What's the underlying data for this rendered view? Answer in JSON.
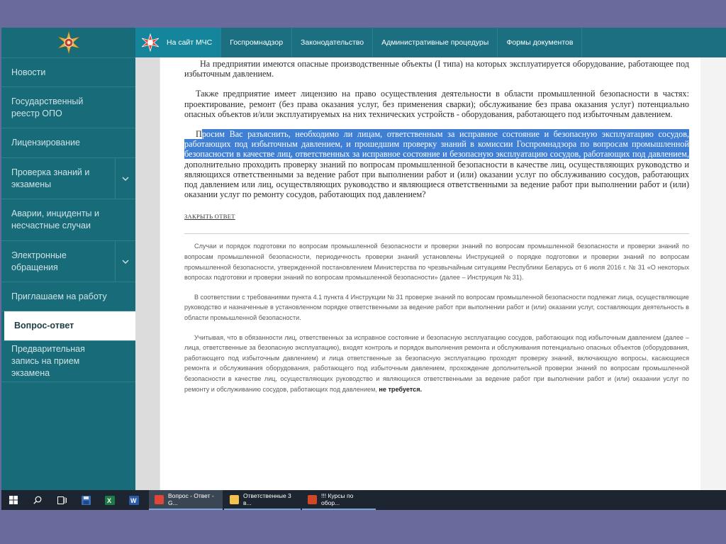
{
  "top_nav": {
    "home_label": "На сайт МЧС",
    "items": [
      "Госпромнадзор",
      "Законодательство",
      "Административные процедуры",
      "Формы документов"
    ]
  },
  "sidebar": {
    "items": [
      {
        "label": "Новости",
        "chevron": false
      },
      {
        "label": "Государственный реестр ОПО",
        "chevron": false
      },
      {
        "label": "Лицензирование",
        "chevron": false
      },
      {
        "label": "Проверка знаний и экзамены",
        "chevron": true
      },
      {
        "label": "Аварии, инциденты и несчастные случаи",
        "chevron": false
      },
      {
        "label": "Электронные обращения",
        "chevron": true
      },
      {
        "label": "Приглашаем на работу",
        "chevron": false
      },
      {
        "label": "Вопрос-ответ",
        "chevron": false,
        "active": true
      },
      {
        "label": "Предварительная запись на прием экзамена",
        "chevron": false
      }
    ]
  },
  "question": {
    "p1": "На предприятии имеются опасные производственные объекты (I типа) на которых эксплуатируется оборудование, работающее под избыточным давлением.",
    "p2": "Также предприятие имеет лицензию на право осуществления деятельности в области промышленной безопасности в частях: проектирование, ремонт (без права оказания услуг, без применения сварки); обслуживание без права оказания услуг) потенциально опасных объектов и/или эксплуатируемых на них технических устройств - оборудования, работающего под избыточным давлением.",
    "p3_first_letter": "П",
    "p3_highlighted": "росим Вас разъяснить, необходимо ли лицам, ответственным за исправное состояние и безопасную эксплуатацию сосудов, работающих под избыточным давлением, и прошедшим проверку знаний в комиссии Госпромнадзора по вопросам промышленной безопасности в качестве лиц, ответственных за исправное состояние и безопасную эксплуатацию сосудов, работающих под давлением,",
    "p3_rest": " дополнительно проходить проверку знаний по вопросам промышленной безопасности в качестве лиц, осуществляющих руководство и являющихся ответственными за ведение работ при выполнении работ и (или) оказании услуг по обслуживанию сосудов, работающих под давлением или лиц, осуществляющих руководство и являющиеся ответственными за ведение работ при выполнении работ и (или) оказании услуг по ремонту сосудов, работающих под давлением?"
  },
  "close_answer_label": "ЗАКРЫТЬ ОТВЕТ",
  "answer": {
    "a1": "Случаи и порядок подготовки по вопросам промышленной безопасности и проверки знаний по вопросам промышленной безопасности и проверки знаний по вопросам промышленной безопасности, периодичность проверки знаний установлены Инструкцией о порядке подготовки и проверки знаний по вопросам промышленной безопасности, утвержденной постановлением Министерства по чрезвычайным ситуациям Республики Беларусь от 6 июля 2016 г. № 31 «О некоторых вопросах подготовки и проверки знаний по вопросам промышленной безопасности» (далее – Инструкция № 31).",
    "a2": "В соответствии с требованиями пункта 4.1 пункта 4 Инструкции № 31 проверке знаний по вопросам промышленной безопасности подлежат лица, осуществляющие руководство и назначенные в установленном порядке ответственными за ведение работ при выполнении работ и (или) оказании услуг, составляющих деятельность в области промышленной безопасности.",
    "a3": "Учитывая, что в обязанности лиц, ответственных за исправное состояние и безопасную эксплуатацию сосудов, работающих под избыточным давлением (далее – лица, ответственные за безопасную эксплуатацию), входят контроль и порядок выполнения ремонта и обслуживания потенциально опасных объектов (оборудования, работающего под избыточным давлением) и лица ответственные за безопасную эксплуатацию проходят проверку знаний, включающую вопросы, касающиеся ремонта и обслуживания оборудования, работающего под избыточным давлением, прохождение дополнительной проверки знаний по вопросам промышленной безопасности в качестве лиц, осуществляющих руководство и являющихся ответственными за ведение работ при выполнении работ и (или) оказании услуг по ремонту и обслуживанию сосудов, работающих под давлением,",
    "a3_bold": "не требуется."
  },
  "taskbar": {
    "apps": [
      {
        "label": "Вопрос - Ответ - G...",
        "icon": "chrome-icon",
        "color": "#e0453a",
        "active": true
      },
      {
        "label": "Ответственные 3 в...",
        "icon": "folder-icon",
        "color": "#f2c14e",
        "active": false
      },
      {
        "label": "!!! Курсы  по обор...",
        "icon": "powerpoint-icon",
        "color": "#d24726",
        "active": false
      }
    ]
  },
  "colors": {
    "sidebar": "#186b78",
    "top_nav": "#1b6f80",
    "selection": "#3f7fd4",
    "frame": "#6b6a9c"
  }
}
